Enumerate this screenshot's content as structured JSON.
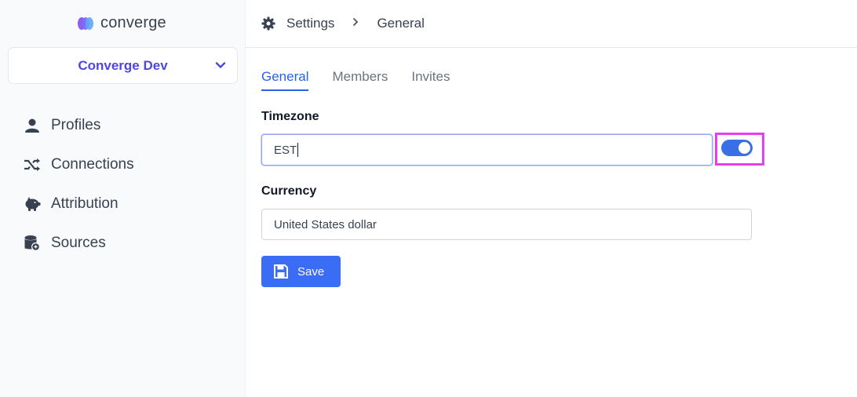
{
  "brand": {
    "name": "converge",
    "logo_colors": [
      "#8b5cf6",
      "#60a5fa"
    ]
  },
  "org": {
    "name": "Converge Dev"
  },
  "sidebar": {
    "items": [
      {
        "label": "Profiles",
        "icon": "user-icon"
      },
      {
        "label": "Connections",
        "icon": "shuffle-icon"
      },
      {
        "label": "Attribution",
        "icon": "piggy-bank-icon"
      },
      {
        "label": "Sources",
        "icon": "database-icon"
      }
    ]
  },
  "breadcrumb": {
    "section": "Settings",
    "page": "General",
    "icon": "gear-icon"
  },
  "tabs": [
    {
      "label": "General",
      "active": true
    },
    {
      "label": "Members",
      "active": false
    },
    {
      "label": "Invites",
      "active": false
    }
  ],
  "form": {
    "timezone": {
      "label": "Timezone",
      "value": "EST"
    },
    "toggle": {
      "on": true
    },
    "currency": {
      "label": "Currency",
      "value": "United States dollar"
    },
    "save_label": "Save"
  },
  "colors": {
    "accent": "#3b6cf6",
    "org_text": "#4f46e5",
    "highlight": "#e63ef0"
  }
}
